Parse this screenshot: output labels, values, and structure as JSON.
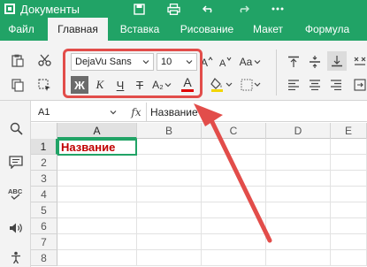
{
  "app": {
    "title": "Документы"
  },
  "tabs": [
    {
      "label": "Файл",
      "active": false
    },
    {
      "label": "Главная",
      "active": true
    },
    {
      "label": "Вставка",
      "active": false
    },
    {
      "label": "Рисование",
      "active": false
    },
    {
      "label": "Макет",
      "active": false
    },
    {
      "label": "Формула",
      "active": false
    }
  ],
  "ribbon": {
    "font_name": "DejaVu Sans",
    "font_size": "10",
    "bold_label": "Ж",
    "italic_label": "К",
    "underline_label": "Ч",
    "strike_label": "Т",
    "subscript_label": "A₂",
    "font_color_label": "A",
    "case_label": "Aa",
    "font_color": "#e00000",
    "fill_color": "#f2d500"
  },
  "formula_bar": {
    "cell_ref": "A1",
    "fx_label": "fx",
    "content": "Название"
  },
  "grid": {
    "columns": [
      "A",
      "B",
      "C",
      "D",
      "E"
    ],
    "rows": [
      "1",
      "2",
      "3",
      "4",
      "5",
      "6",
      "7",
      "8"
    ],
    "selected_cell": "A1",
    "a1_value": "Название",
    "a1_color": "#c00000"
  },
  "colors": {
    "brand": "#21a366",
    "callout": "#e24d4a"
  }
}
